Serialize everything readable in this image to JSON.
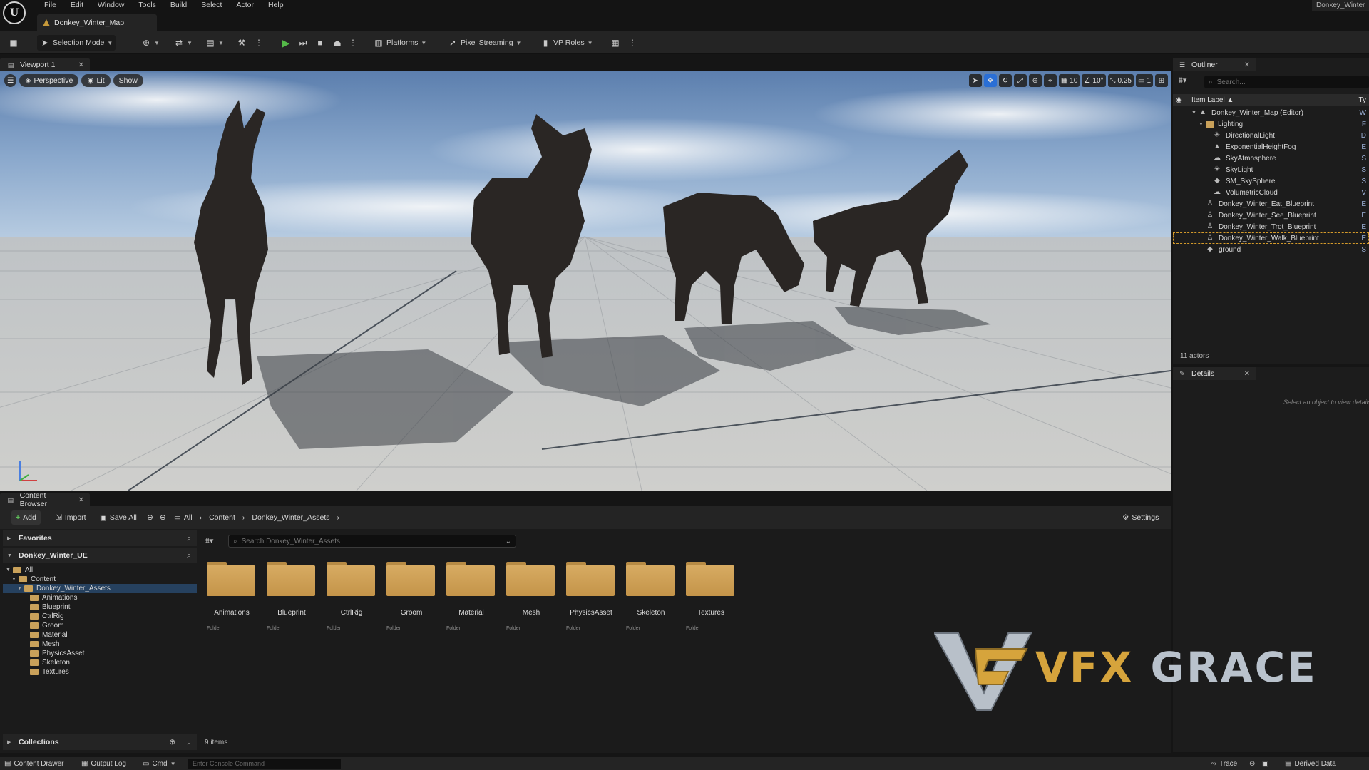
{
  "app": {
    "logo_letter": "U",
    "project_name": "Donkey_Winter",
    "map_tab": "Donkey_Winter_Map"
  },
  "menu": [
    "File",
    "Edit",
    "Window",
    "Tools",
    "Build",
    "Select",
    "Actor",
    "Help"
  ],
  "toolbar": {
    "selection_mode": "Selection Mode",
    "platforms": "Platforms",
    "pixel_streaming": "Pixel Streaming",
    "vp_roles": "VP Roles"
  },
  "viewport": {
    "tab": "Viewport 1",
    "perspective": "Perspective",
    "lit": "Lit",
    "show": "Show",
    "grid_snap": "10",
    "rotation_snap": "10°",
    "scale_snap": "0.25",
    "camera_speed": "1"
  },
  "outliner": {
    "tab": "Outliner",
    "search_placeholder": "Search...",
    "column_label": "Item Label ▲",
    "column_type": "Ty",
    "items": [
      {
        "label": "Donkey_Winter_Map (Editor)",
        "type": "W"
      },
      {
        "label": "Lighting",
        "type": "F"
      },
      {
        "label": "DirectionalLight",
        "type": "D"
      },
      {
        "label": "ExponentialHeightFog",
        "type": "E"
      },
      {
        "label": "SkyAtmosphere",
        "type": "S"
      },
      {
        "label": "SkyLight",
        "type": "S"
      },
      {
        "label": "SM_SkySphere",
        "type": "S"
      },
      {
        "label": "VolumetricCloud",
        "type": "V"
      },
      {
        "label": "Donkey_Winter_Eat_Blueprint",
        "type": "E"
      },
      {
        "label": "Donkey_Winter_See_Blueprint",
        "type": "E"
      },
      {
        "label": "Donkey_Winter_Trot_Blueprint",
        "type": "E"
      },
      {
        "label": "Donkey_Winter_Walk_Blueprint",
        "type": "E"
      },
      {
        "label": "ground",
        "type": "S"
      }
    ],
    "actors_count": "11 actors"
  },
  "details": {
    "tab": "Details",
    "empty_message": "Select an object to view details."
  },
  "content_browser": {
    "tab": "Content Browser",
    "add": "Add",
    "import": "Import",
    "save_all": "Save All",
    "breadcrumb": [
      "All",
      "Content",
      "Donkey_Winter_Assets"
    ],
    "settings": "Settings",
    "favorites": "Favorites",
    "project": "Donkey_Winter_UE",
    "tree": [
      "All",
      "Content",
      "Donkey_Winter_Assets",
      "Animations",
      "Blueprint",
      "CtrlRig",
      "Groom",
      "Material",
      "Mesh",
      "PhysicsAsset",
      "Skeleton",
      "Textures"
    ],
    "collections": "Collections",
    "search_placeholder": "Search Donkey_Winter_Assets",
    "assets": [
      {
        "name": "Animations",
        "kind": "Folder"
      },
      {
        "name": "Blueprint",
        "kind": "Folder"
      },
      {
        "name": "CtrlRig",
        "kind": "Folder"
      },
      {
        "name": "Groom",
        "kind": "Folder"
      },
      {
        "name": "Material",
        "kind": "Folder"
      },
      {
        "name": "Mesh",
        "kind": "Folder"
      },
      {
        "name": "PhysicsAsset",
        "kind": "Folder"
      },
      {
        "name": "Skeleton",
        "kind": "Folder"
      },
      {
        "name": "Textures",
        "kind": "Folder"
      }
    ],
    "items_count": "9 items"
  },
  "statusbar": {
    "content_drawer": "Content Drawer",
    "output_log": "Output Log",
    "cmd": "Cmd",
    "console_placeholder": "Enter Console Command",
    "trace": "Trace",
    "derived_data": "Derived Data"
  },
  "watermark": {
    "word1": "VFX",
    "word2": "GRACE"
  },
  "colors": {
    "accent_blue": "#2a6fd6",
    "play_green": "#54b948",
    "folder": "#d1a35c",
    "selection_outline": "#d49a2a"
  }
}
